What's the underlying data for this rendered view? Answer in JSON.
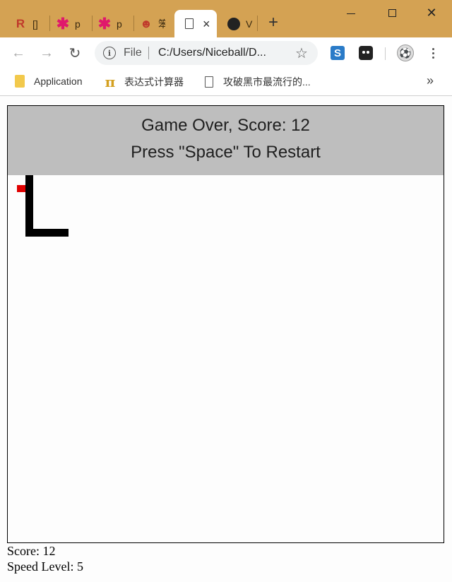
{
  "browser": {
    "tabs": [
      {
        "favicon": "r-logo-icon",
        "title": "[]",
        "color": "#c0392b"
      },
      {
        "favicon": "asterisk-icon",
        "title": "p",
        "color": "#e0186c"
      },
      {
        "favicon": "asterisk-icon",
        "title": "p",
        "color": "#e0186c"
      },
      {
        "favicon": "tiger-icon",
        "title": "笨",
        "color": "#c0392b"
      },
      {
        "favicon": "page-icon",
        "title": "",
        "active": true
      },
      {
        "favicon": "github-icon",
        "title": "V",
        "color": "#222222"
      }
    ],
    "new_tab_label": "+",
    "omnibox": {
      "scheme_label": "File",
      "url": "C:/Users/Niceball/D..."
    },
    "bookmarks": [
      {
        "label": "Application",
        "icon": "folder-icon"
      },
      {
        "label": "表达式计算器",
        "icon": "pi-icon"
      },
      {
        "label": "攻破黑市最流行的...",
        "icon": "page-icon"
      }
    ],
    "bookmarks_more": "»",
    "titlebar_color": "#d4a253"
  },
  "game": {
    "overlay": {
      "line1": "Game Over, Score: 12",
      "line2": "Press \"Space\" To Restart",
      "background": "#bebebe"
    },
    "snake_color": "#000000",
    "food_color": "#e00000"
  },
  "info": {
    "score_text": "Score: 12",
    "speed_text": "Speed Level: 5"
  }
}
